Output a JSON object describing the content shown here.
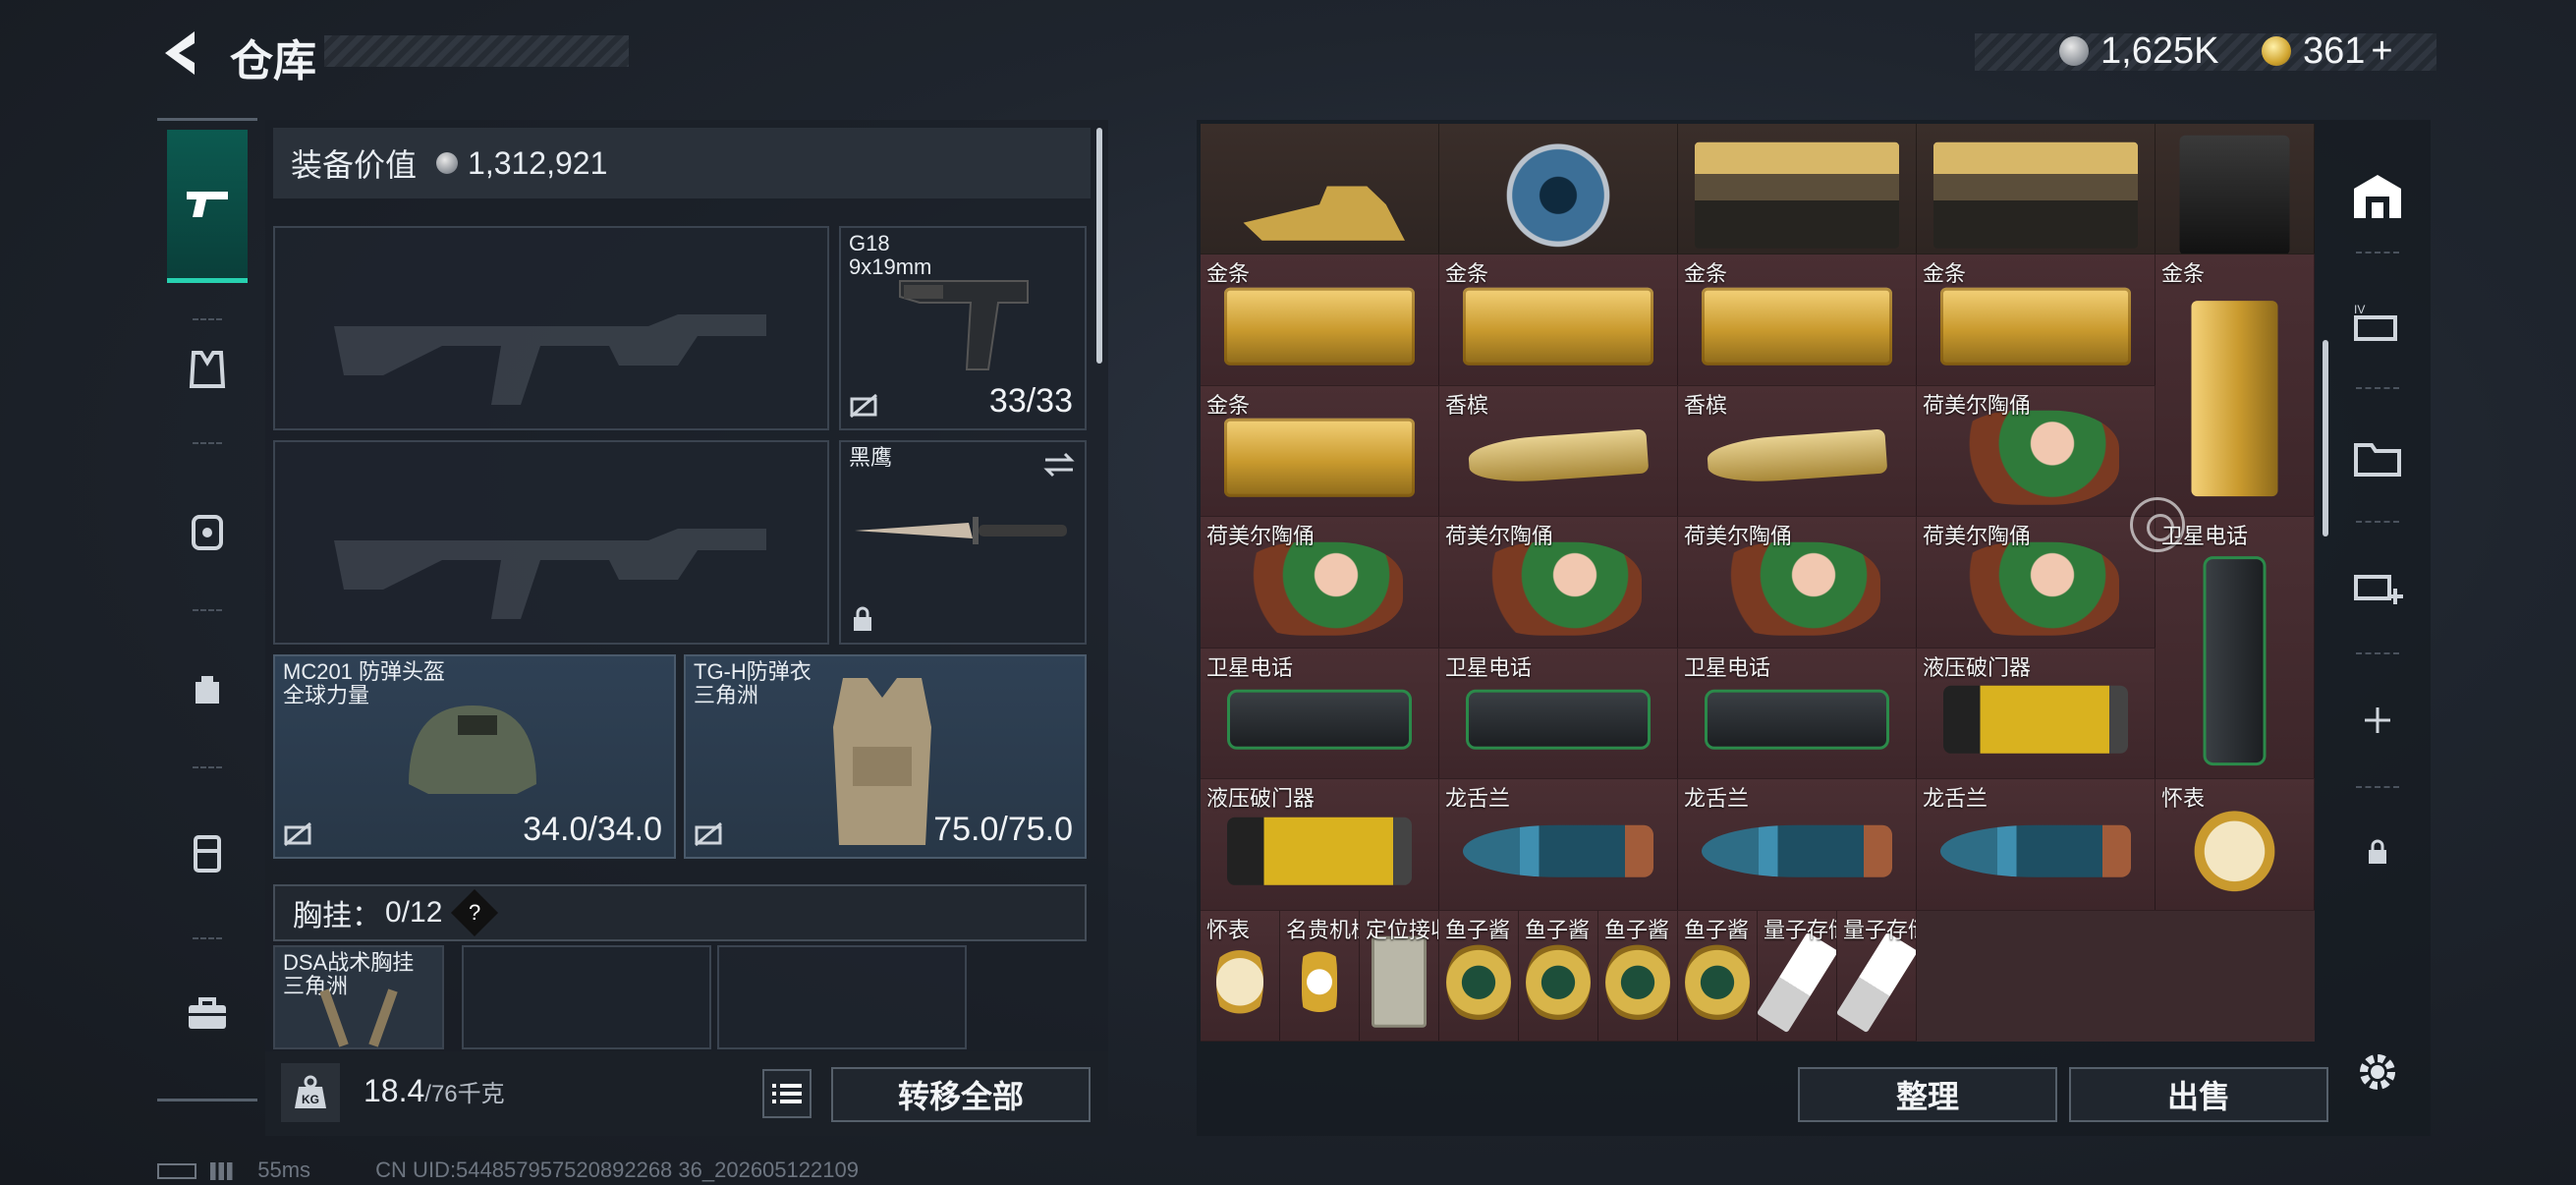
{
  "header": {
    "title": "仓库",
    "silver": "1,625K",
    "gold": "361",
    "gold_plus": "+"
  },
  "equip": {
    "value_label": "装备价值",
    "value": "1,312,921",
    "secondary_weapon": {
      "name": "G18",
      "ammo_type": "9x19mm",
      "ammo": "33/33"
    },
    "melee": {
      "name": "黑鹰"
    },
    "helmet": {
      "name": "MC201 防弹头盔",
      "brand": "全球力量",
      "durability": "34.0/34.0"
    },
    "armor": {
      "name": "TG-H防弹衣",
      "brand": "三角洲",
      "durability": "75.0/75.0"
    },
    "chest_rig": {
      "label": "胸挂：",
      "value": "0/12",
      "help": "?"
    },
    "rig_item": {
      "name": "DSA战术胸挂",
      "brand": "三角洲"
    },
    "weight_value": "18.4",
    "weight_cap": "/76千克",
    "weight_icon": "KG",
    "transfer_all": "转移全部"
  },
  "stash": {
    "sort": "整理",
    "sell": "出售",
    "items": [
      {
        "label": "",
        "art": "deer"
      },
      {
        "label": "",
        "art": "reel"
      },
      {
        "label": "",
        "art": "crate"
      },
      {
        "label": "",
        "art": "crate"
      },
      {
        "label": "",
        "art": "coffee"
      },
      {
        "label": "金条",
        "art": "goldbar"
      },
      {
        "label": "金条",
        "art": "goldbar"
      },
      {
        "label": "金条",
        "art": "goldbar"
      },
      {
        "label": "金条",
        "art": "goldbar"
      },
      {
        "label": "金条",
        "art": "goldbarv"
      },
      {
        "label": "金条",
        "art": "goldbar"
      },
      {
        "label": "香槟",
        "art": "bottle"
      },
      {
        "label": "香槟",
        "art": "bottle"
      },
      {
        "label": "荷美尔陶俑",
        "art": "figurine"
      },
      {
        "label": "荷美尔陶俑",
        "art": "figurine"
      },
      {
        "label": "荷美尔陶俑",
        "art": "figurine"
      },
      {
        "label": "荷美尔陶俑",
        "art": "figurine"
      },
      {
        "label": "荷美尔陶俑",
        "art": "figurine"
      },
      {
        "label": "卫星电话",
        "art": "phonev"
      },
      {
        "label": "卫星电话",
        "art": "phone"
      },
      {
        "label": "卫星电话",
        "art": "phone"
      },
      {
        "label": "卫星电话",
        "art": "phone"
      },
      {
        "label": "液压破门器",
        "art": "breacher"
      },
      {
        "label": "液压破门器",
        "art": "breacher"
      },
      {
        "label": "龙舌兰",
        "art": "orb"
      },
      {
        "label": "龙舌兰",
        "art": "orb"
      },
      {
        "label": "龙舌兰",
        "art": "orb"
      },
      {
        "label": "怀表",
        "art": "watch"
      },
      {
        "label": "怀表",
        "art": "watch"
      },
      {
        "label": "名贵机械表",
        "art": "watch2"
      },
      {
        "label": "定位接收器",
        "art": "locator"
      },
      {
        "label": "鱼子酱",
        "art": "caviar"
      },
      {
        "label": "鱼子酱",
        "art": "caviar"
      },
      {
        "label": "鱼子酱",
        "art": "caviar"
      },
      {
        "label": "鱼子酱",
        "art": "caviar"
      },
      {
        "label": "量子存储",
        "art": "qstore"
      },
      {
        "label": "量子存储",
        "art": "qstore"
      }
    ]
  },
  "right_tabs": [
    "warehouse-icon",
    "stash-tab-iv-icon",
    "stash-tab-folder-icon",
    "stash-tab-add-icon",
    "plus-icon",
    "lock-icon"
  ],
  "footer": {
    "ping": "55ms",
    "uid": "CN UID:544857957520892268 36_202605122109"
  }
}
